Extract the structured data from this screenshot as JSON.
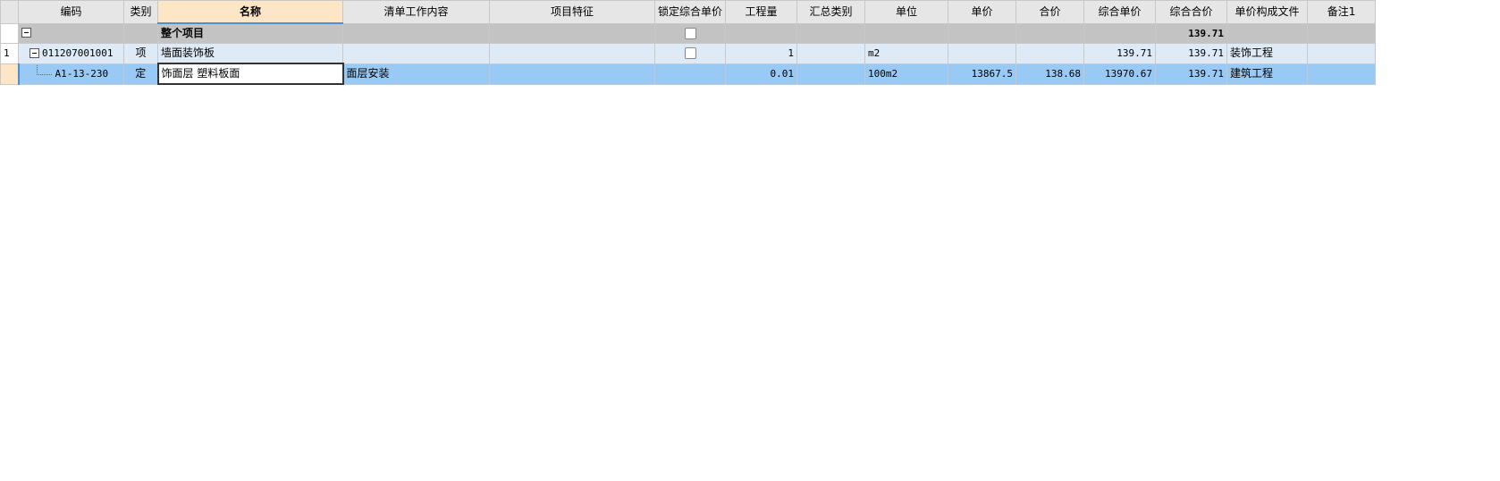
{
  "columns": [
    "编码",
    "类别",
    "名称",
    "清单工作内容",
    "项目特征",
    "锁定综合单价",
    "工程量",
    "汇总类别",
    "单位",
    "单价",
    "合价",
    "综合单价",
    "综合合价",
    "单价构成文件",
    "备注1"
  ],
  "selected_column": "名称",
  "rows": {
    "total": {
      "row_no": "",
      "name": "整个项目",
      "composite_total": "139.71",
      "lock_checked": false
    },
    "item": {
      "row_no": "1",
      "code": "011207001001",
      "category": "项",
      "name": "墙面装饰板",
      "quantity": "1",
      "unit": "m2",
      "composite_unit_price": "139.71",
      "composite_total": "139.71",
      "price_file": "装饰工程",
      "lock_checked": false
    },
    "sub": {
      "row_no": "",
      "code": "A1-13-230",
      "category": "定",
      "name": "饰面层 塑料板面",
      "work_content": "面层安装",
      "quantity": "0.01",
      "unit": "100m2",
      "unit_price": "13867.5",
      "total_price": "138.68",
      "composite_unit_price": "13970.67",
      "composite_total": "139.71",
      "price_file": "建筑工程"
    }
  }
}
